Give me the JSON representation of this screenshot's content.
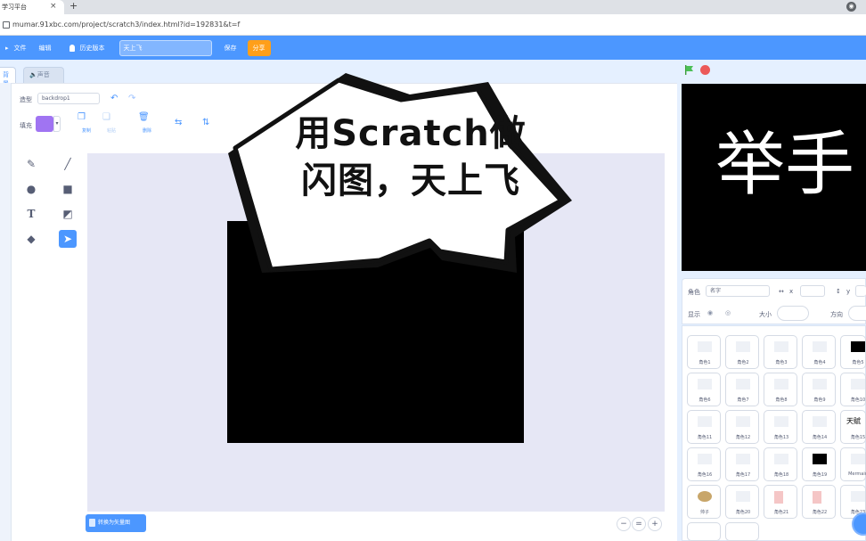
{
  "browser": {
    "tab_title": "学习平台",
    "tab_close": "×",
    "new_tab": "+",
    "url": "mumar.91xbc.com/project/scratch3/index.html?id=192831&t=f"
  },
  "menubar": {
    "file": "文件",
    "edit": "编辑",
    "history": "历史版本",
    "project_title": "天上飞",
    "save": "保存",
    "share": "分享"
  },
  "editor_tabs": [
    "背景",
    "声音"
  ],
  "paint": {
    "costume_label": "造型",
    "costume_name": "backdrop1",
    "fill_label": "填充",
    "swatch_arrow": "▾",
    "copy": "复制",
    "paste": "粘贴",
    "delete": "删除",
    "convert_button": "转换为矢量图",
    "zoom_out": "−",
    "zoom_reset": "=",
    "zoom_in": "+"
  },
  "overlay": {
    "bubble_text": "用Scratch做闪图，天上飞"
  },
  "stage": {
    "text": "举手"
  },
  "sprite_info": {
    "sprite_label": "角色",
    "sprite_placeholder": "名字",
    "x_label": "x",
    "y_label": "y",
    "show_label": "显示",
    "size_label": "大小",
    "direction_label": "方向"
  },
  "sprites": [
    "角色1",
    "角色2",
    "角色3",
    "角色4",
    "角色5",
    "角色6",
    "角色7",
    "角色8",
    "角色9",
    "角色10",
    "角色11",
    "角色12",
    "角色13",
    "角色14",
    "角色15",
    "角色16",
    "角色17",
    "角色18",
    "角色19",
    "Mermaid",
    "帅子",
    "角色20",
    "角色21",
    "角色22",
    "角色23"
  ],
  "sprite_thumbs": {
    "tile15": "天赋"
  },
  "colors": {
    "menubar": "#4c97ff",
    "share": "#ff9f1a",
    "fill": "#a074f2",
    "canvas": "#e6e7f5"
  }
}
